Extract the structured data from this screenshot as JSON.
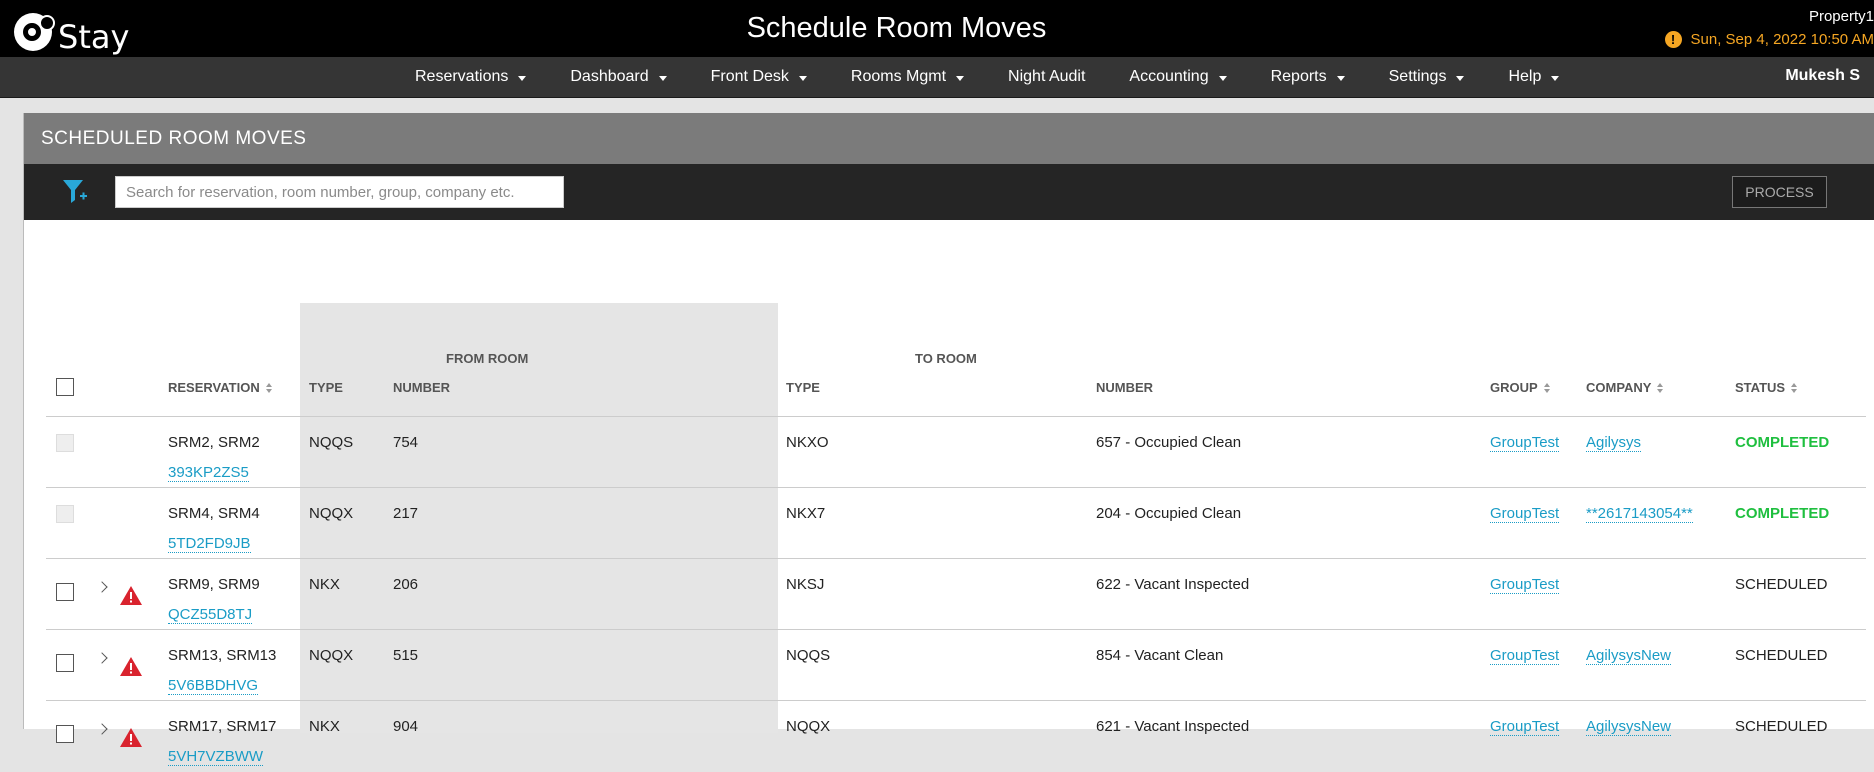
{
  "app": {
    "logo_text": "Stay",
    "title": "Schedule Room Moves",
    "property": "Property1",
    "datetime": "Sun, Sep 4, 2022 10:50 AM",
    "warning_glyph": "!"
  },
  "nav": {
    "items": [
      "Reservations",
      "Dashboard",
      "Front Desk",
      "Rooms Mgmt",
      "Night Audit",
      "Accounting",
      "Reports",
      "Settings",
      "Help"
    ],
    "user": "Mukesh S"
  },
  "panel": {
    "title": "SCHEDULED ROOM MOVES",
    "search_placeholder": "Search for reservation, room number, group, company etc.",
    "process_label": "PROCESS"
  },
  "table": {
    "group_from": "FROM ROOM",
    "group_to": "TO ROOM",
    "headers": {
      "reservation": "RESERVATION",
      "from_type": "TYPE",
      "from_number": "NUMBER",
      "to_type": "TYPE",
      "to_number": "NUMBER",
      "group": "GROUP",
      "company": "COMPANY",
      "status": "STATUS"
    },
    "rows": [
      {
        "name": "SRM2, SRM2",
        "confirm": "393KP2ZS5",
        "from_type": "NQQS",
        "from_number": "754",
        "to_type": "NKXO",
        "to_number": "657 - Occupied Clean",
        "group": "GroupTest",
        "company": "Agilysys",
        "status": "COMPLETED"
      },
      {
        "name": "SRM4, SRM4",
        "confirm": "5TD2FD9JB",
        "from_type": "NQQX",
        "from_number": "217",
        "to_type": "NKX7",
        "to_number": "204 - Occupied Clean",
        "group": "GroupTest",
        "company": "**2617143054**",
        "status": "COMPLETED"
      },
      {
        "name": "SRM9, SRM9",
        "confirm": "QCZ55D8TJ",
        "from_type": "NKX",
        "from_number": "206",
        "to_type": "NKSJ",
        "to_number": "622 - Vacant Inspected",
        "group": "GroupTest",
        "company": "",
        "status": "SCHEDULED"
      },
      {
        "name": "SRM13, SRM13",
        "confirm": "5V6BBDHVG",
        "from_type": "NQQX",
        "from_number": "515",
        "to_type": "NQQS",
        "to_number": "854 - Vacant Clean",
        "group": "GroupTest",
        "company": "AgilysysNew",
        "status": "SCHEDULED"
      },
      {
        "name": "SRM17, SRM17",
        "confirm": "5VH7VZBWW",
        "from_type": "NKX",
        "from_number": "904",
        "to_type": "NQQX",
        "to_number": "621 - Vacant Inspected",
        "group": "GroupTest",
        "company": "AgilysysNew",
        "status": "SCHEDULED"
      }
    ]
  },
  "colors": {
    "link": "#1a9cc6",
    "completed": "#1fbf3f",
    "warning": "#f5a623",
    "alert": "#d9232e"
  },
  "icons": [
    "filter-icon",
    "warning-icon",
    "alert-triangle-icon",
    "chevron-right-icon",
    "sort-icon",
    "caret-down-icon"
  ]
}
